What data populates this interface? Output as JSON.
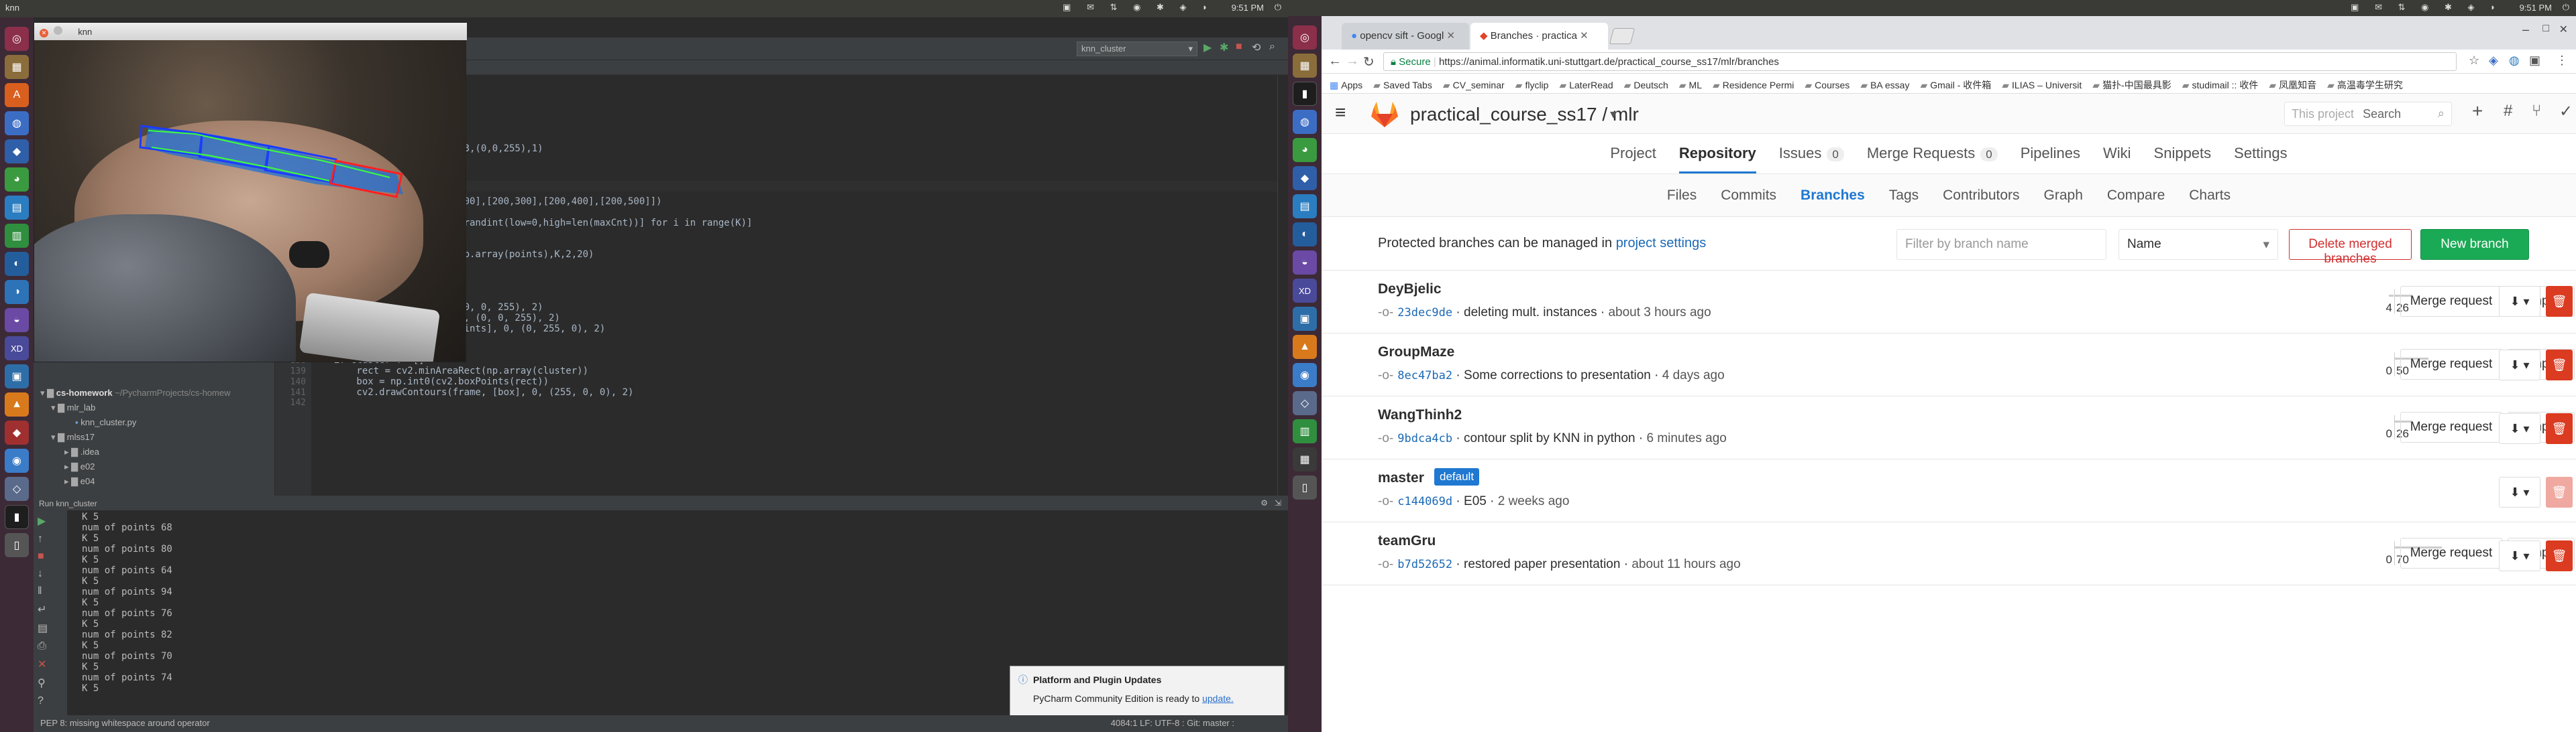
{
  "left_screen": {
    "top_bar": {
      "app": "knn",
      "time": "9:51 PM"
    },
    "knn_window": {
      "title": "knn"
    },
    "pycharm": {
      "run_config": "knn_cluster",
      "editor": {
        "lines": [
          {
            "num": "",
            "text": "cv2.convexHull(points)"
          },
          {
            "num": "",
            "text": "lygon(points, False)"
          },
          {
            "num": "",
            "text": " cv2.minAreaRect(points)"
          },
          {
            "num": "",
            "text": "in points:"
          },
          {
            "num": "",
            "text": "2.circle(image,(p[0],p[1]),3,(0,0,255),1)"
          },
          {
            "num": "",
            "text": "2,len(points)/12])"
          },
          {
            "num": "",
            "text": ""
          },
          {
            "num": "",
            "text": " K"
          },
          {
            "num": "",
            "text": "randomInit(K,2,500)"
          },
          {
            "num": "",
            "text": " np.array([[200,100],[200,200],[200,300],[200,400],[200,500]])"
          },
          {
            "num": "",
            "text": "center = []"
          },
          {
            "num": "",
            "text": "center = [maxCnt[np.random.randint(low=0,high=len(maxCnt))] for i in range(K)]"
          },
          {
            "num": "",
            "text": ""
          },
          {
            "num": "",
            "text": "nit"
          },
          {
            "num": "",
            "text": "clusters = knn(old_center,np.array(points),K,2,20)"
          },
          {
            "num": "",
            "text": "ter = list(centers)"
          },
          {
            "num": "",
            "text": "centers"
          },
          {
            "num": "",
            "text": "cv2.minAreaRect(points)"
          },
          {
            "num": "",
            "text": ".int0(cv2.boxPoints(rect))"
          },
          {
            "num": "",
            "text": "Contours(frame, [box], 0, (0, 0, 255), 2)"
          },
          {
            "num": "",
            "text": "awContours(frame, [hull], 0, (0, 0, 255), 2)"
          },
          {
            "num": "135",
            "text": "cv2.drawContours(frame, [points], 0, (0, 255, 0), 2)"
          },
          {
            "num": "136",
            "text": ""
          },
          {
            "num": "137",
            "text": "for cluster in clusters:"
          },
          {
            "num": "138",
            "text": "    if cluster != []"
          },
          {
            "num": "139",
            "text": "        rect = cv2.minAreaRect(np.array(cluster))"
          },
          {
            "num": "140",
            "text": "        box = np.int0(cv2.boxPoints(rect))"
          },
          {
            "num": "141",
            "text": "        cv2.drawContours(frame, [box], 0, (255, 0, 0), 2)"
          },
          {
            "num": "142",
            "text": ""
          }
        ]
      },
      "project_tree": [
        {
          "label": "cs-homework",
          "extra": "~/PycharmProjects/cs-homew"
        },
        {
          "label": "mlr_lab",
          "extra": ""
        },
        {
          "label": "knn_cluster.py",
          "extra": ""
        },
        {
          "label": "mlss17",
          "extra": ""
        },
        {
          "label": ".idea",
          "extra": ""
        },
        {
          "label": "e02",
          "extra": ""
        },
        {
          "label": "e04",
          "extra": ""
        }
      ],
      "run_panel": {
        "tab": "Run  knn_cluster",
        "output": [
          "K  5",
          "num of points 68",
          "K  5",
          "num of points 80",
          "K  5",
          "num of points 64",
          "K  5",
          "num of points 94",
          "K  5",
          "num of points 76",
          "K  5",
          "num of points 82",
          "K  5",
          "num of points 70",
          "K  5",
          "num of points 74",
          "K  5"
        ]
      },
      "notification": {
        "title": "Platform and Plugin Updates",
        "body": "PyCharm Community Edition is ready to",
        "link": "update."
      },
      "status_bar": {
        "message": "PEP 8: missing whitespace around operator",
        "right": "4084:1  LF:  UTF-8 :  Git: master :"
      }
    }
  },
  "right_screen": {
    "top_bar": {
      "time": "9:51 PM"
    },
    "tabs": [
      {
        "label": "opencv sift - Googl"
      },
      {
        "label": "Branches · practica"
      }
    ],
    "address": {
      "secure": "Secure",
      "url": "https://animal.informatik.uni-stuttgart.de/practical_course_ss17/mlr/branches"
    },
    "bookmarks": [
      "Apps",
      "Saved Tabs",
      "CV_seminar",
      "flyclip",
      "LaterRead",
      "Deutsch",
      "ML",
      "Residence Permi",
      "Courses",
      "BA essay",
      "Gmail - 收件箱",
      "ILIAS – Universit",
      "猫扑-中国最具影",
      "studimail :: 收件",
      "凤凰知音",
      "高温毒学生研究"
    ],
    "gitlab": {
      "project": "practical_course_ss17 / mlr",
      "search_scope": "This project",
      "search_placeholder": "Search",
      "nav": [
        {
          "label": "Project",
          "count": ""
        },
        {
          "label": "Repository",
          "count": ""
        },
        {
          "label": "Issues",
          "count": "0"
        },
        {
          "label": "Merge Requests",
          "count": "0"
        },
        {
          "label": "Pipelines",
          "count": ""
        },
        {
          "label": "Wiki",
          "count": ""
        },
        {
          "label": "Snippets",
          "count": ""
        },
        {
          "label": "Settings",
          "count": ""
        }
      ],
      "subnav": [
        "Files",
        "Commits",
        "Branches",
        "Tags",
        "Contributors",
        "Graph",
        "Compare",
        "Charts"
      ],
      "protected_text": "Protected branches can be managed in",
      "protected_link": "project settings",
      "filter_placeholder": "Filter by branch name",
      "sort_label": "Name",
      "delete_merged": "Delete merged branches",
      "new_branch": "New branch",
      "merge_request_label": "Merge request",
      "compare_label": "Compare",
      "branches": [
        {
          "name": "DeyBjelic",
          "badge": "",
          "sha": "23dec9de",
          "message": "deleting mult. instances",
          "time": "about 3 hours ago",
          "behind": "4",
          "ahead": "26",
          "behind_frac": 0.1,
          "ahead_frac": 0.37,
          "merge": true
        },
        {
          "name": "GroupMaze",
          "badge": "",
          "sha": "8ec47ba2",
          "message": "Some corrections to presentation",
          "time": "4 days ago",
          "behind": "0",
          "ahead": "50",
          "behind_frac": 0.0,
          "ahead_frac": 0.71,
          "merge": true
        },
        {
          "name": "WangThinh2",
          "badge": "",
          "sha": "9bdca4cb",
          "message": "contour split by KNN in python",
          "time": "6 minutes ago",
          "behind": "0",
          "ahead": "26",
          "behind_frac": 0.0,
          "ahead_frac": 0.37,
          "merge": true
        },
        {
          "name": "master",
          "badge": "default",
          "sha": "c144069d",
          "message": "E05",
          "time": "2 weeks ago",
          "behind": "",
          "ahead": "",
          "behind_frac": 0.0,
          "ahead_frac": 0.0,
          "merge": false
        },
        {
          "name": "teamGru",
          "badge": "",
          "sha": "b7d52652",
          "message": "restored paper presentation",
          "time": "about 11 hours ago",
          "behind": "0",
          "ahead": "70",
          "behind_frac": 0.0,
          "ahead_frac": 1.0,
          "merge": true
        }
      ]
    }
  }
}
